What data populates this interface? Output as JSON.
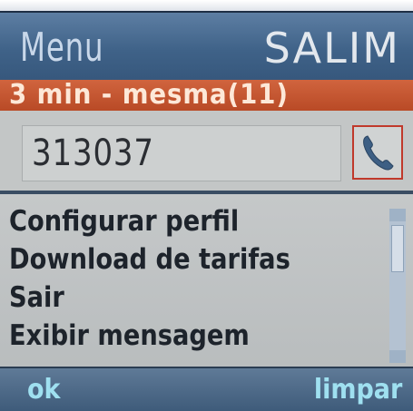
{
  "header": {
    "title": "Menu",
    "brand": "SALIM"
  },
  "status": {
    "text": "3 min - mesma(11)"
  },
  "dial": {
    "number": "313037",
    "call_icon": "phone-handset-icon"
  },
  "menu": {
    "items": [
      {
        "label": "Configurar perfil"
      },
      {
        "label": "Download de tarifas"
      },
      {
        "label": "Sair"
      },
      {
        "label": "Exibir mensagem"
      }
    ]
  },
  "softkeys": {
    "left": "ok",
    "right": "limpar"
  },
  "colors": {
    "header": "#3f6288",
    "status_bar": "#c4532d",
    "list_background": "#c5c8c9",
    "softkey_bar": "#4a6686",
    "softkey_text": "#9fe0f0",
    "call_border": "#c0392b"
  }
}
